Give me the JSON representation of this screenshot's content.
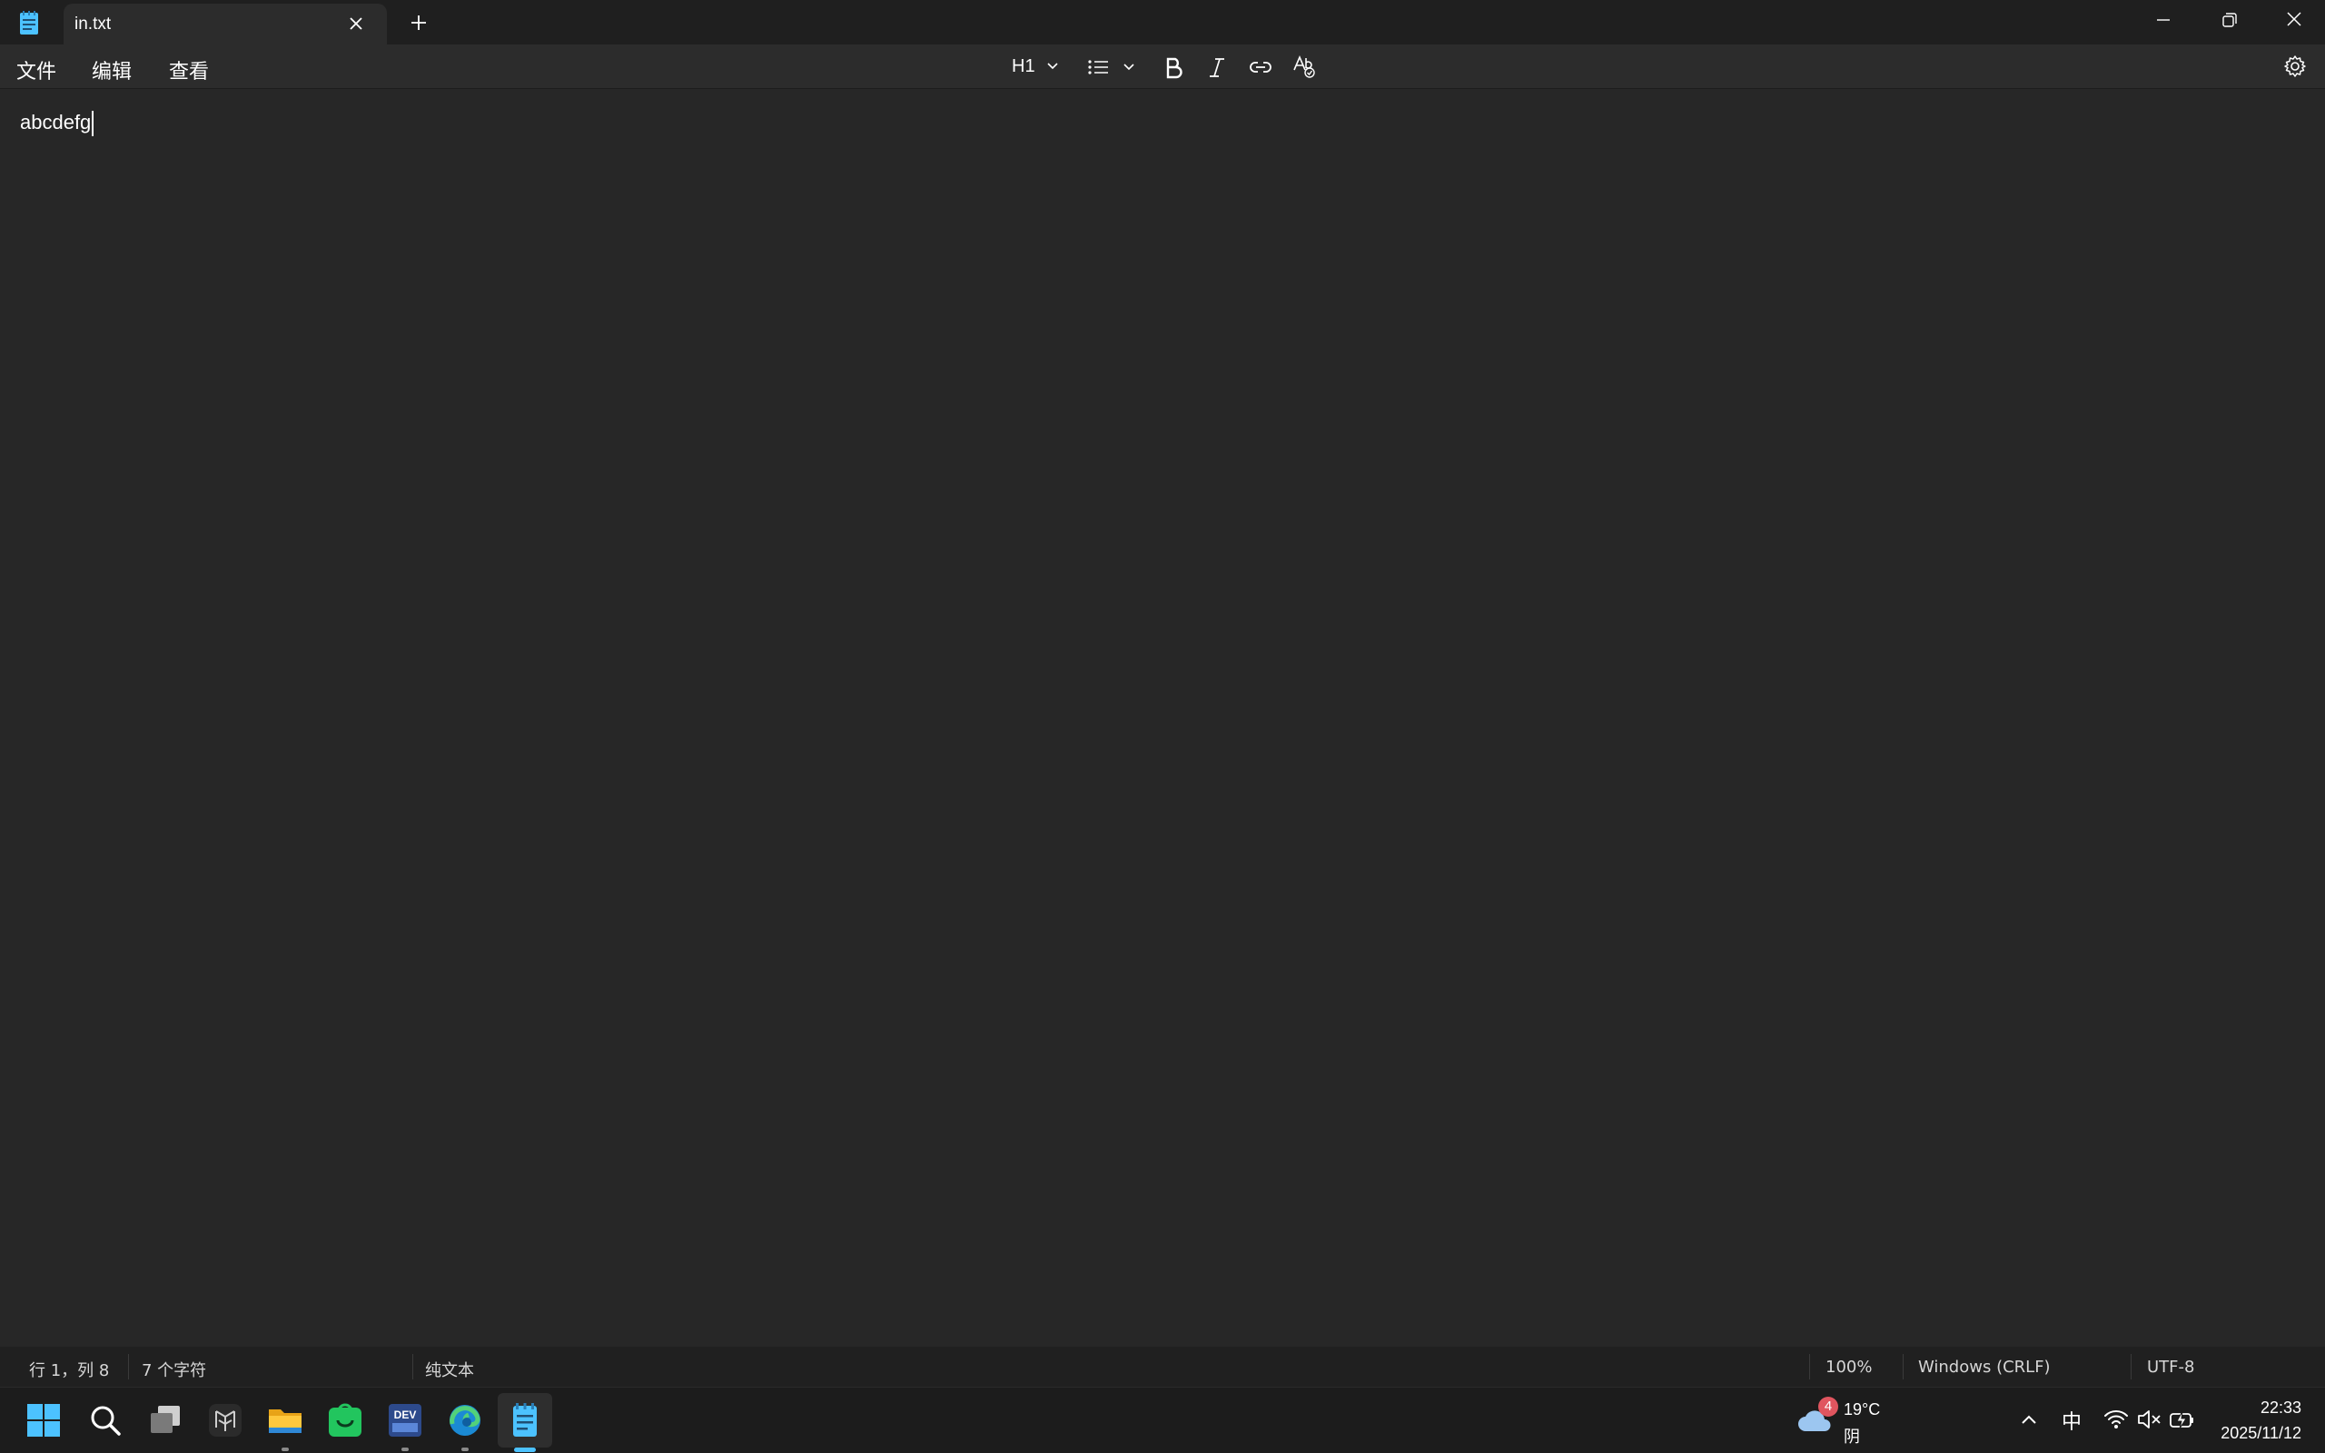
{
  "titlebar": {
    "tab_title": "in.txt"
  },
  "menu": {
    "file": "文件",
    "edit": "编辑",
    "view": "查看"
  },
  "toolbar": {
    "heading_label": "H1"
  },
  "editor": {
    "content": "abcdefg"
  },
  "statusbar": {
    "position": "行 1，列 8",
    "char_count": "7 个字符",
    "format": "纯文本",
    "zoom": "100%",
    "line_ending": "Windows (CRLF)",
    "encoding": "UTF-8"
  },
  "taskbar": {
    "weather_badge": "4",
    "weather_temp": "19°C",
    "weather_condition": "阴",
    "ime_indicator": "中",
    "time": "22:33",
    "date": "2025/11/12"
  },
  "colors": {
    "accent": "#4cc2ff",
    "background": "#272727",
    "titlebar": "#1f1f1f"
  }
}
